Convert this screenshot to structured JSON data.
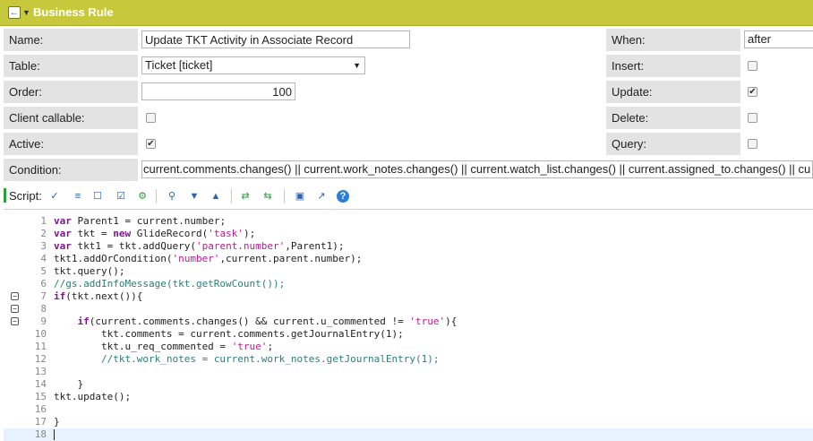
{
  "titlebar": {
    "title": "Business Rule",
    "back_icon": "back-arrow-icon",
    "menu_icon": "menu-dropdown-icon",
    "color": "#c7c83b"
  },
  "form": {
    "name": {
      "label": "Name:",
      "value": "Update TKT Activity in Associate Record"
    },
    "table": {
      "label": "Table:",
      "value": "Ticket [ticket]"
    },
    "order": {
      "label": "Order:",
      "value": "100"
    },
    "client_callable": {
      "label": "Client callable:",
      "checked": false
    },
    "active": {
      "label": "Active:",
      "checked": true
    },
    "condition": {
      "label": "Condition:",
      "value": "current.comments.changes() || current.work_notes.changes() || current.watch_list.changes() || current.assigned_to.changes() || cu"
    },
    "when": {
      "label": "When:",
      "value": "after"
    },
    "insert": {
      "label": "Insert:",
      "checked": false
    },
    "update": {
      "label": "Update:",
      "checked": true
    },
    "delete": {
      "label": "Delete:",
      "checked": false
    },
    "query": {
      "label": "Query:",
      "checked": false
    }
  },
  "script": {
    "label": "Script:",
    "check_mark": "✔",
    "toolbar_icons": [
      "syntax-check-icon",
      "format-code-icon",
      "comment-icon",
      "uncomment-icon",
      "debug-icon",
      "search-icon",
      "find-next-icon",
      "find-previous-icon",
      "replace-icon",
      "replace-all-icon",
      "save-icon",
      "fullscreen-icon",
      "help-icon"
    ],
    "lines": [
      {
        "n": "1",
        "text": "var Parent1 = current.number;"
      },
      {
        "n": "2",
        "text": "var tkt = new GlideRecord('task');"
      },
      {
        "n": "3",
        "text": "var tkt1 = tkt.addQuery('parent.number',Parent1);"
      },
      {
        "n": "4",
        "text": "tkt1.addOrCondition('number',current.parent.number);"
      },
      {
        "n": "5",
        "text": "tkt.query();"
      },
      {
        "n": "6",
        "text": "//gs.addInfoMessage(tkt.getRowCount());"
      },
      {
        "n": "7",
        "text": "if(tkt.next()){"
      },
      {
        "n": "8",
        "text": ""
      },
      {
        "n": "9",
        "text": "    if(current.comments.changes() && current.u_commented != 'true'){"
      },
      {
        "n": "10",
        "text": "        tkt.comments = current.comments.getJournalEntry(1);"
      },
      {
        "n": "11",
        "text": "        tkt.u_req_commented = 'true';"
      },
      {
        "n": "12",
        "text": "        //tkt.work_notes = current.work_notes.getJournalEntry(1);"
      },
      {
        "n": "13",
        "text": ""
      },
      {
        "n": "14",
        "text": "    }"
      },
      {
        "n": "15",
        "text": "tkt.update();"
      },
      {
        "n": "16",
        "text": ""
      },
      {
        "n": "17",
        "text": "}"
      },
      {
        "n": "18",
        "text": ""
      }
    ]
  }
}
